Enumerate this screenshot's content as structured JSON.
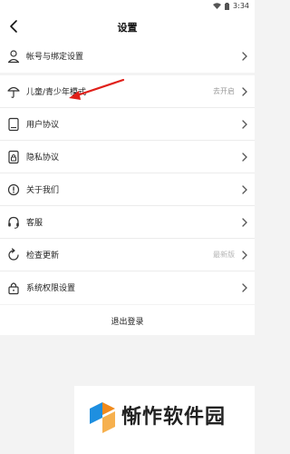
{
  "status_bar": {
    "time": "3:34"
  },
  "header": {
    "title": "设置"
  },
  "account": {
    "label": "帐号与绑定设置"
  },
  "settings": [
    {
      "label": "儿童/青少年模式",
      "value": "去开启"
    },
    {
      "label": "用户协议"
    },
    {
      "label": "隐私协议"
    },
    {
      "label": "关于我们"
    },
    {
      "label": "客服"
    },
    {
      "label": "检查更新",
      "value": "最新版"
    },
    {
      "label": "系统权限设置"
    }
  ],
  "logout": {
    "label": "退出登录"
  },
  "watermark": {
    "text": "惭怍软件园"
  },
  "colors": {
    "arrow": "#e0201a",
    "watermark_blue": "#1e8fe0",
    "watermark_orange": "#f08a1c"
  }
}
